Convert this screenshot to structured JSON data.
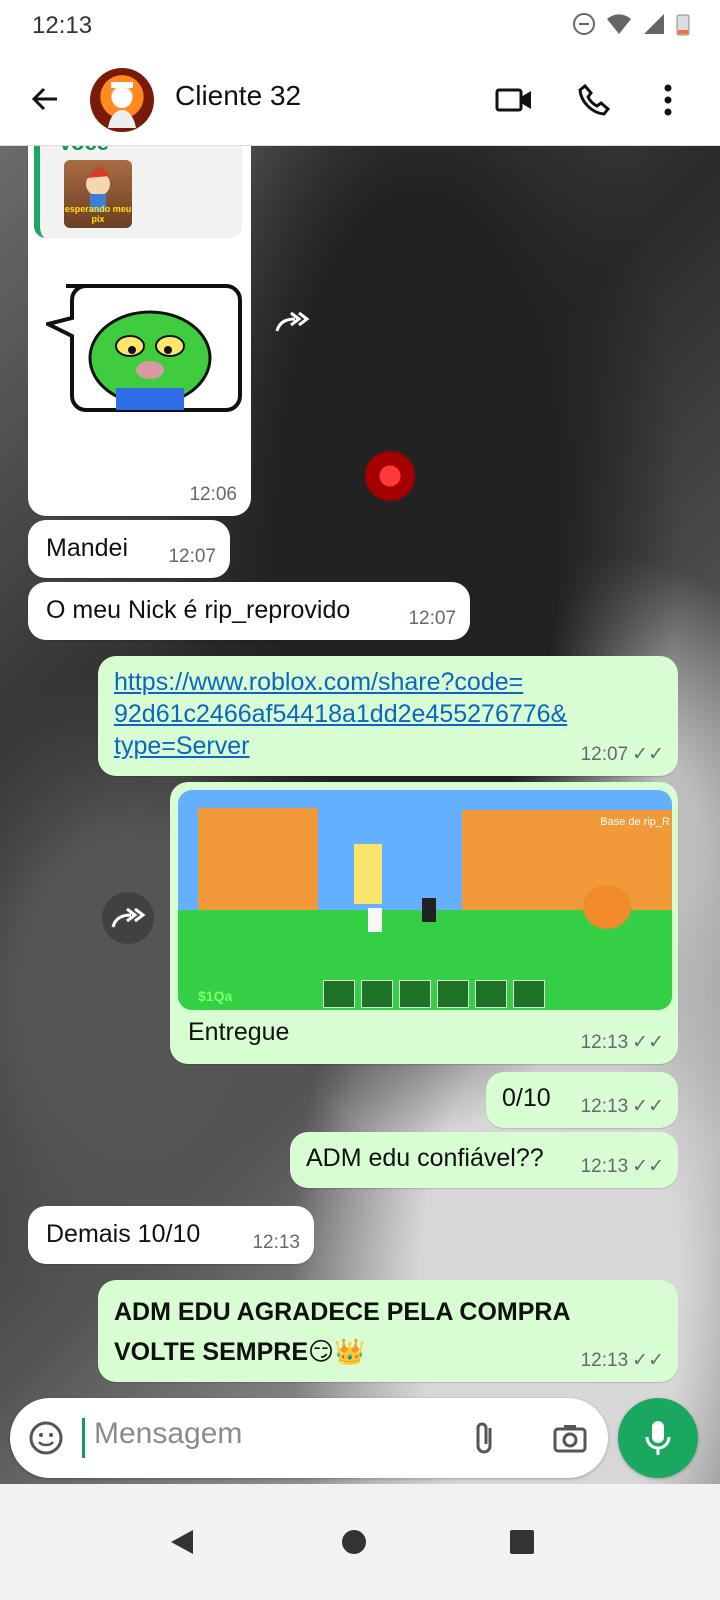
{
  "status": {
    "time": "12:13"
  },
  "header": {
    "contact_name": "Cliente 32",
    "avatar_icon": "contact-avatar",
    "icons": [
      "arrow-left-icon",
      "video-call-icon",
      "phone-icon",
      "more-vertical-icon"
    ]
  },
  "messages": [
    {
      "type": "incoming",
      "reply_to": "Você",
      "time": "12:06"
    },
    {
      "type": "incoming",
      "text": "Mandei",
      "time": "12:07"
    },
    {
      "type": "incoming",
      "text": "O meu Nick é rip_reprovido",
      "time": "12:07"
    },
    {
      "type": "outgoing",
      "link_line1": "https://www.roblox.com/share?code=",
      "link_line2": "92d61c2466af54418a1dd2e455276776&",
      "link_line3": "type=Server",
      "time": "12:07"
    },
    {
      "type": "outgoing",
      "caption": "Entregue",
      "time": "12:13",
      "image_label": "Base de rip_R",
      "image_cash": "$1Qa"
    },
    {
      "type": "outgoing",
      "text": "0/10",
      "time": "12:13"
    },
    {
      "type": "outgoing",
      "text": "ADM edu confiável??",
      "time": "12:13"
    },
    {
      "type": "incoming",
      "text": "Demais 10/10",
      "time": "12:13"
    },
    {
      "type": "outgoing",
      "line1": "ADM EDU AGRADECE PELA COMPRA",
      "line2": "VOLTE SEMPRE",
      "emojis": "😏👑",
      "time": "12:13"
    }
  ],
  "reply_preview": {
    "sender": "Você",
    "thumb_text": "esperando meu pix"
  },
  "composer": {
    "placeholder": "Mensagem"
  },
  "colors": {
    "outgoing_bubble": "#d9fdd3",
    "accent": "#1aa760",
    "link": "#0a66c2"
  }
}
